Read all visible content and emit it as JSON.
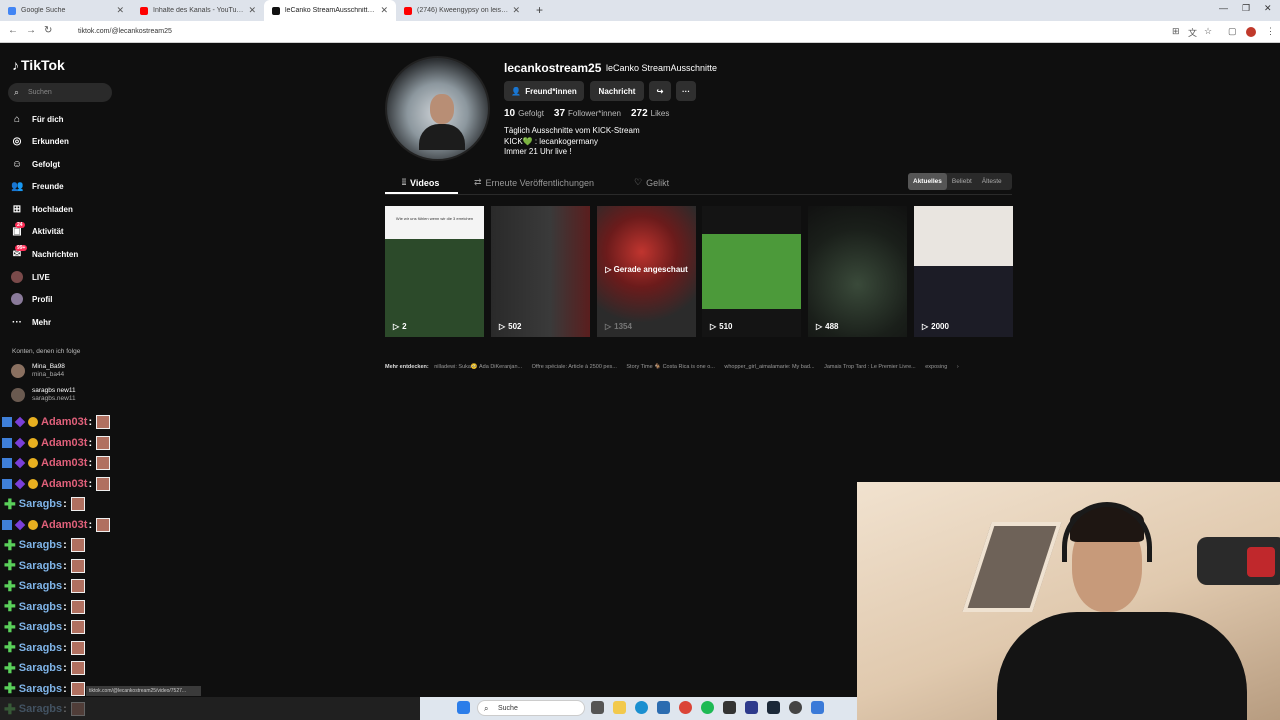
{
  "browser": {
    "tabs": [
      {
        "title": "Google Suche",
        "color": "#4285f4"
      },
      {
        "title": "Inhalte des Kanals - YouTube St...",
        "color": "#ff0000"
      },
      {
        "title": "leCanko StreamAusschnitte (@l...",
        "color": "#111111"
      },
      {
        "title": "(2746) Kweengypsy on leise gü...",
        "color": "#ff0000"
      }
    ],
    "url": "tiktok.com/@lecankostream25"
  },
  "sidebar": {
    "logo": "TikTok",
    "search_placeholder": "Suchen",
    "nav": [
      {
        "label": "Für dich",
        "icon": "home-icon"
      },
      {
        "label": "Erkunden",
        "icon": "compass-icon"
      },
      {
        "label": "Gefolgt",
        "icon": "following-icon"
      },
      {
        "label": "Freunde",
        "icon": "friends-icon"
      },
      {
        "label": "Hochladen",
        "icon": "upload-icon"
      },
      {
        "label": "Aktivität",
        "icon": "activity-icon",
        "badge": "24"
      },
      {
        "label": "Nachrichten",
        "icon": "messages-icon",
        "badge": "99+"
      },
      {
        "label": "LIVE",
        "icon": "live-icon"
      },
      {
        "label": "Profil",
        "icon": "profile-icon"
      },
      {
        "label": "Mehr",
        "icon": "more-icon"
      }
    ],
    "following_heading": "Konten, denen ich folge",
    "following": [
      {
        "name": "Mina_Ba98",
        "handle": "mina_ba44"
      },
      {
        "name": "saragbs new11",
        "handle": "saragbs.new11"
      }
    ]
  },
  "profile": {
    "username": "lecankostream25",
    "display_name": "leCanko StreamAusschnitte",
    "buttons": {
      "friends": "Freund*innen",
      "message": "Nachricht"
    },
    "stats": [
      {
        "value": "10",
        "label": "Gefolgt"
      },
      {
        "value": "37",
        "label": "Follower*innen"
      },
      {
        "value": "272",
        "label": "Likes"
      }
    ],
    "bio": [
      "Täglich Ausschnitte vom KICK-Stream",
      "KICK💚 : lecankogermany",
      "Immer 21 Uhr live !"
    ],
    "tabs": [
      "Videos",
      "Erneute Veröffentlichungen",
      "Gelikt"
    ],
    "sort": [
      "Aktuelles",
      "Beliebt",
      "Älteste"
    ],
    "videos": [
      {
        "views": "2",
        "caption": "Wie wir uns fühlen wenn wir die 3 erreichen"
      },
      {
        "views": "502"
      },
      {
        "views": "1354",
        "overlay": "Gerade angeschaut"
      },
      {
        "views": "510"
      },
      {
        "views": "488"
      },
      {
        "views": "2000"
      }
    ],
    "discover_label": "Mehr entdecken:",
    "discover": [
      "nilladewi: Suka🥺 Ada DiKeranjan...",
      "Offre spéciale: Article à 2500 pes...",
      "Story Time 🐐 Costa Rica is one o...",
      "whopper_girl_aimalamarie: My bad...",
      "Jamais Trop Tard : Le Premier Livre...",
      "exposing"
    ]
  },
  "chat": [
    {
      "user": "Adam03t",
      "type": "adam"
    },
    {
      "user": "Adam03t",
      "type": "adam"
    },
    {
      "user": "Adam03t",
      "type": "adam"
    },
    {
      "user": "Adam03t",
      "type": "adam"
    },
    {
      "user": "Saragbs",
      "type": "sara"
    },
    {
      "user": "Adam03t",
      "type": "adam"
    },
    {
      "user": "Saragbs",
      "type": "sara"
    },
    {
      "user": "Saragbs",
      "type": "sara"
    },
    {
      "user": "Saragbs",
      "type": "sara"
    },
    {
      "user": "Saragbs",
      "type": "sara"
    },
    {
      "user": "Saragbs",
      "type": "sara"
    },
    {
      "user": "Saragbs",
      "type": "sara"
    },
    {
      "user": "Saragbs",
      "type": "sara"
    },
    {
      "user": "Saragbs",
      "type": "sara"
    },
    {
      "user": "Saragbs",
      "type": "sara"
    }
  ],
  "taskbar": {
    "search": "Suche"
  },
  "status_url": "tiktok.com/@lecankostream25/video/7527..."
}
